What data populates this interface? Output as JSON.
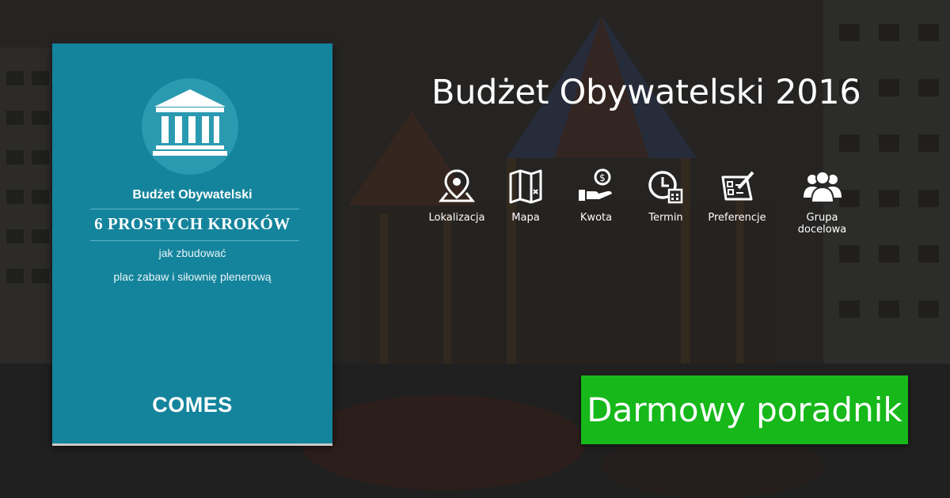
{
  "book": {
    "title": "Budżet Obywatelski",
    "steps": "6  PROSTYCH KROKÓW",
    "subtitle_line1": "jak zbudować",
    "subtitle_line2": "plac zabaw i siłownię plenerową",
    "brand": "COMES",
    "icon": "bank-icon",
    "color": "#14849c"
  },
  "headline": "Budżet Obywatelski 2016",
  "features": [
    {
      "label": "Lokalizacja",
      "icon": "map-pin-icon"
    },
    {
      "label": "Mapa",
      "icon": "map-icon"
    },
    {
      "label": "Kwota",
      "icon": "money-hand-icon"
    },
    {
      "label": "Termin",
      "icon": "clock-calendar-icon"
    },
    {
      "label": "Preferencje",
      "icon": "checklist-pen-icon"
    },
    {
      "label": "Grupa docelowa",
      "icon": "group-icon"
    }
  ],
  "cta": {
    "label": "Darmowy poradnik",
    "color": "#16b81a"
  }
}
